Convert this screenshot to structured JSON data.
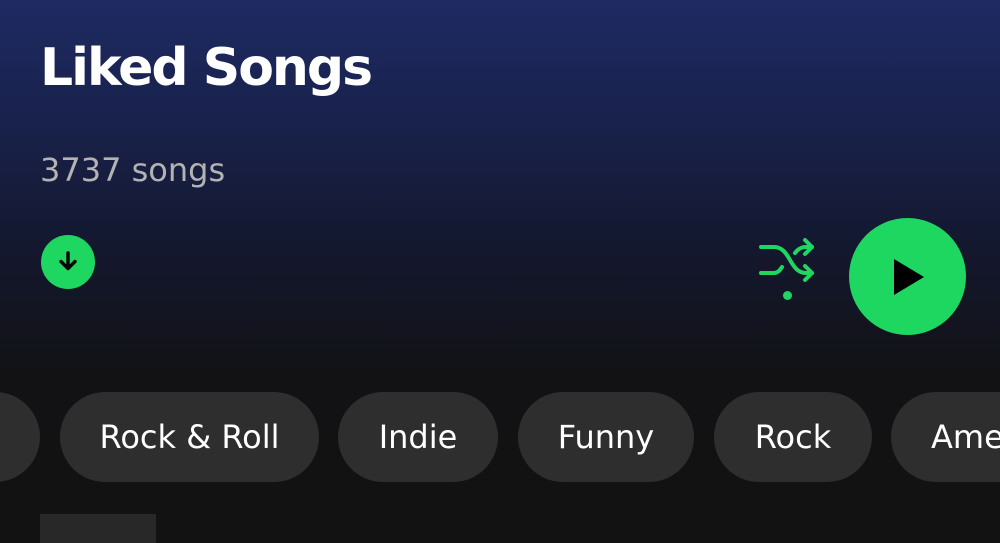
{
  "header": {
    "title": "Liked Songs",
    "song_count": "3737 songs"
  },
  "controls": {
    "download_icon": "download-arrow-icon",
    "shuffle_icon": "shuffle-icon",
    "play_icon": "play-icon",
    "accent_color": "#1ed760"
  },
  "filters": {
    "chips": [
      {
        "label": ""
      },
      {
        "label": "Rock & Roll"
      },
      {
        "label": "Indie"
      },
      {
        "label": "Funny"
      },
      {
        "label": "Rock"
      },
      {
        "label": "Ame"
      }
    ]
  },
  "colors": {
    "header_gradient_top": "#1e2a62",
    "background": "#121212",
    "chip_background": "#2e2e2e",
    "secondary_text": "#b3b3b3"
  }
}
